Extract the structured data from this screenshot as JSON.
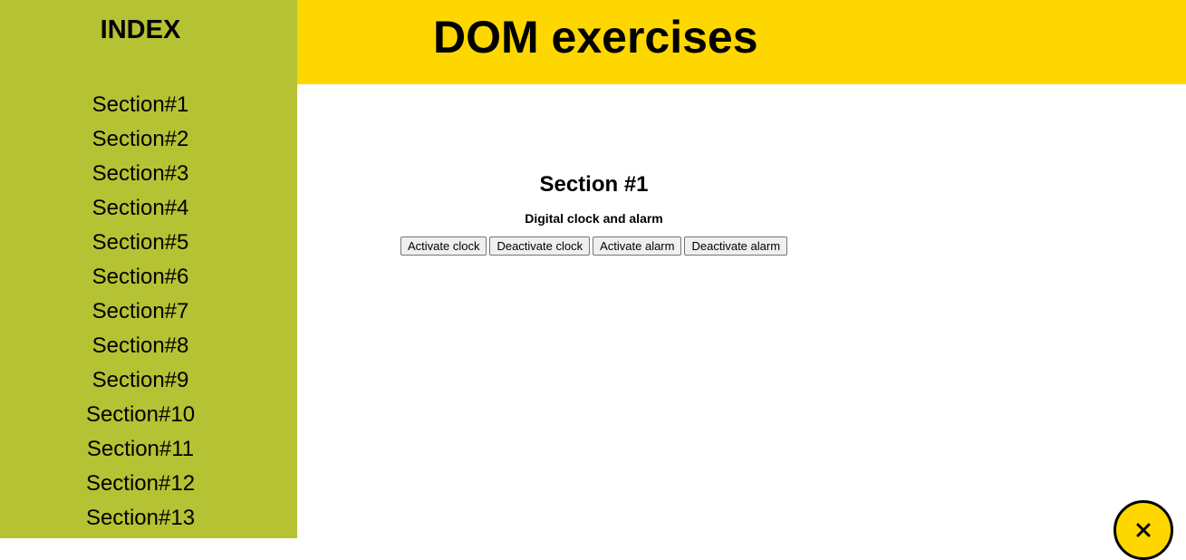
{
  "sidebar": {
    "title": "INDEX",
    "items": [
      {
        "label": "Section#1"
      },
      {
        "label": "Section#2"
      },
      {
        "label": "Section#3"
      },
      {
        "label": "Section#4"
      },
      {
        "label": "Section#5"
      },
      {
        "label": "Section#6"
      },
      {
        "label": "Section#7"
      },
      {
        "label": "Section#8"
      },
      {
        "label": "Section#9"
      },
      {
        "label": "Section#10"
      },
      {
        "label": "Section#11"
      },
      {
        "label": "Section#12"
      },
      {
        "label": "Section#13"
      }
    ],
    "background_color": "#b5c233"
  },
  "header": {
    "title": "DOM exercises",
    "background_color": "#ffd700"
  },
  "section": {
    "title": "Section #1",
    "subtitle": "Digital clock and alarm",
    "buttons": {
      "activate_clock": "Activate clock",
      "deactivate_clock": "Deactivate clock",
      "activate_alarm": "Activate alarm",
      "deactivate_alarm": "Deactivate alarm"
    }
  },
  "close_button": {
    "icon": "close-icon",
    "background_color": "#ffd700"
  }
}
